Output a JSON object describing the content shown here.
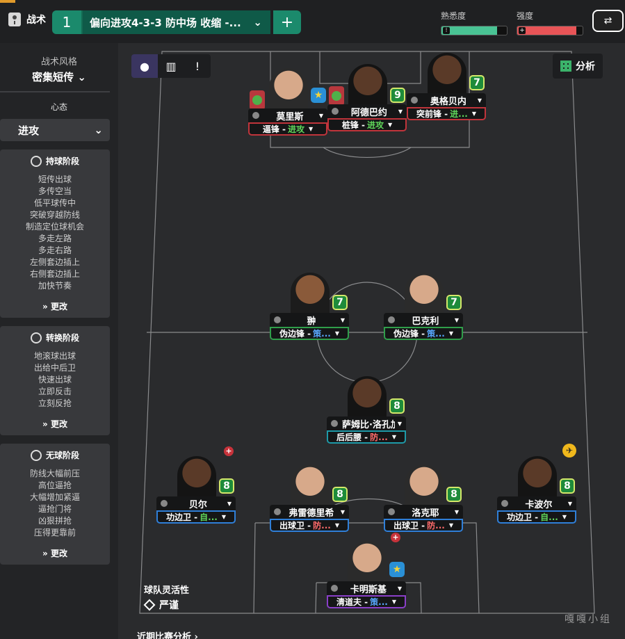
{
  "topbar": {
    "tactics_label": "战术",
    "formation_number": "1",
    "formation_name": "偏向进攻4-3-3 防中场 收缩 -...",
    "familiarity_label": "熟悉度",
    "familiarity_level": 0.85,
    "intensity_label": "强度",
    "intensity_level": 0.9,
    "accent_color": "#e09a2b"
  },
  "sidebar": {
    "style_label": "战术风格",
    "style_value": "密集短传",
    "mentality_label": "心态",
    "mentality_value": "进攻",
    "phases": [
      {
        "title": "持球阶段",
        "items": [
          "短传出球",
          "多传空当",
          "低平球传中",
          "突破穿越防线",
          "制造定位球机会",
          "多走左路",
          "多走右路",
          "左侧套边插上",
          "右侧套边插上",
          "加快节奏"
        ],
        "change": "更改"
      },
      {
        "title": "转换阶段",
        "items": [
          "地滚球出球",
          "出给中后卫",
          "快速出球",
          "立即反击",
          "立刻反抢"
        ],
        "change": "更改"
      },
      {
        "title": "无球阶段",
        "items": [
          "防线大幅前压",
          "高位逼抢",
          "大幅增加紧逼",
          "逼抢门将",
          "凶狠拼抢",
          "压得更靠前"
        ],
        "change": "更改"
      }
    ]
  },
  "pitch": {
    "analysis_label": "分析",
    "flexibility_label": "球队灵活性",
    "flexibility_value": "严谨",
    "recent_label": "近期比赛分析 ›",
    "watermark": "嘎嘎小组"
  },
  "players": {
    "p1": {
      "name": "莫里斯",
      "role": "逼锋",
      "duty": "进攻",
      "rating": ""
    },
    "p2": {
      "name": "阿德巴约",
      "role": "桩锋",
      "duty": "进攻",
      "rating": "9"
    },
    "p3": {
      "name": "奥格贝内",
      "role": "突前锋",
      "duty": "进...",
      "rating": "7"
    },
    "p4": {
      "name": "翀",
      "role": "伪边锋",
      "duty": "策...",
      "rating": "7"
    },
    "p5": {
      "name": "巴克利",
      "role": "伪边锋",
      "duty": "策...",
      "rating": "7"
    },
    "p6": {
      "name": "萨姆比·洛孔加",
      "role": "后后腰",
      "duty": "防...",
      "rating": "8"
    },
    "p7": {
      "name": "贝尔",
      "role": "功边卫",
      "duty": "自...",
      "rating": "8"
    },
    "p8": {
      "name": "弗雷德里希",
      "role": "出球卫",
      "duty": "防...",
      "rating": "8"
    },
    "p9": {
      "name": "洛克耶",
      "role": "出球卫",
      "duty": "防...",
      "rating": "8"
    },
    "p10": {
      "name": "卡波尔",
      "role": "功边卫",
      "duty": "自...",
      "rating": "8"
    },
    "p11": {
      "name": "卡明斯基",
      "role": "清道夫",
      "duty": "策...",
      "rating": ""
    }
  }
}
